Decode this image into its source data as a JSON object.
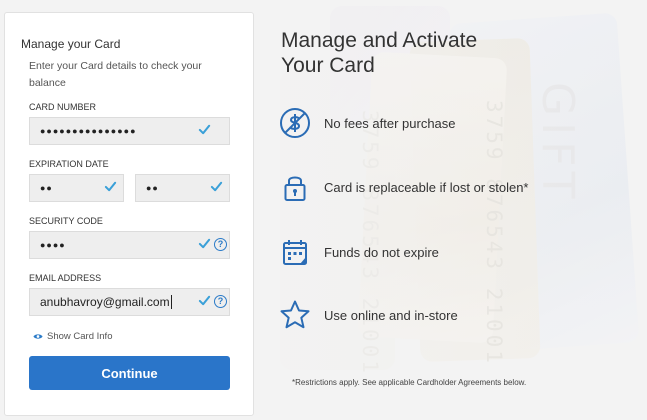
{
  "form": {
    "title": "Manage your Card",
    "subtitle": "Enter your Card details to check your balance",
    "card_number": {
      "label": "CARD NUMBER",
      "value": "●●●●●●●●●●●●●●●"
    },
    "expiration": {
      "label": "EXPIRATION DATE",
      "month_value": "●●",
      "year_value": "●●"
    },
    "security_code": {
      "label": "SECURITY CODE",
      "value": "●●●●",
      "help": "?"
    },
    "email": {
      "label": "EMAIL ADDRESS",
      "value": "anubhavroy@gmail.com",
      "help": "?"
    },
    "show_card_info": "Show Card Info",
    "continue_label": "Continue"
  },
  "hero": {
    "title_line1": "Manage and Activate",
    "title_line2": "Your Card"
  },
  "features": [
    {
      "icon": "no-fee-icon",
      "text": "No fees after purchase"
    },
    {
      "icon": "lock-icon",
      "text": "Card is replaceable if lost or stolen*"
    },
    {
      "icon": "calendar-icon",
      "text": "Funds do not expire"
    },
    {
      "icon": "star-icon",
      "text": "Use online and in-store"
    }
  ],
  "footnote": "*Restrictions apply. See applicable Cardholder Agreements below.",
  "colors": {
    "accent": "#2a75c9",
    "check": "#3aa0d8",
    "icon_blue": "#2b6cb5",
    "field_bg": "#eeeeee"
  }
}
